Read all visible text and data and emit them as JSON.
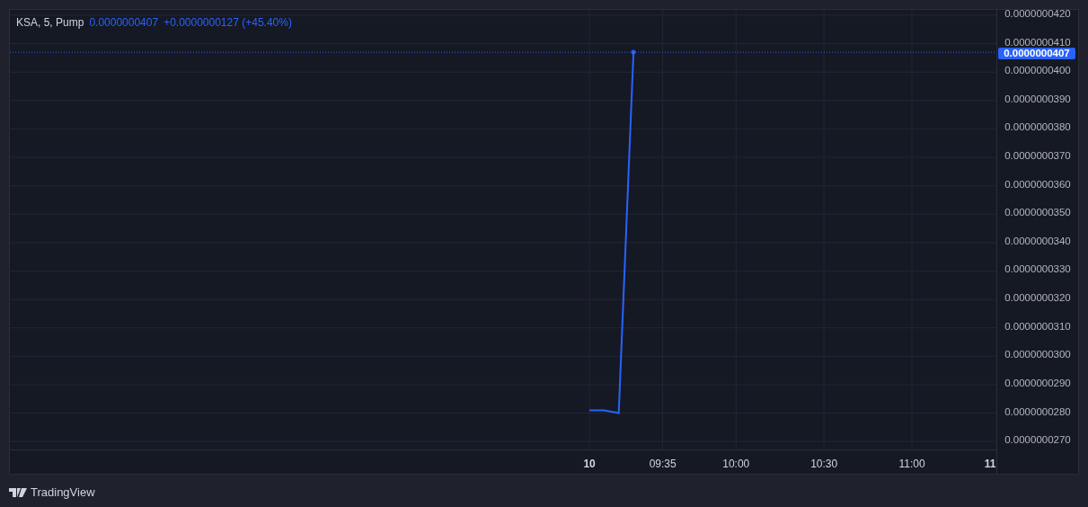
{
  "legend": {
    "symbol": "KSA, 5, Pump",
    "price": "0.0000000407",
    "change": "+0.0000000127 (+45.40%)"
  },
  "chart_data": {
    "type": "line",
    "x": [
      550,
      555,
      560,
      565
    ],
    "series": [
      {
        "color": "#2962ff",
        "values": [
          2.81e-08,
          2.81e-08,
          2.8e-08,
          4.07e-08
        ]
      }
    ],
    "xlim": [
      352.3,
      689.1
    ],
    "ylim": [
      2.672e-08,
      4.219e-08
    ],
    "grid": true,
    "ref_lines": [
      {
        "axis": "y",
        "value": 4.07e-08,
        "label": "0.0000000407"
      }
    ],
    "xticks": [
      {
        "value": 575,
        "label": "09:35"
      },
      {
        "value": 600,
        "label": "10:00"
      },
      {
        "value": 630,
        "label": "10:30"
      },
      {
        "value": 660,
        "label": "11:00"
      }
    ],
    "yticks": [
      {
        "value": 4.2e-08,
        "label": "0.0000000420"
      },
      {
        "value": 4.1e-08,
        "label": "0.0000000410"
      },
      {
        "value": 4e-08,
        "label": "0.0000000400"
      },
      {
        "value": 3.9e-08,
        "label": "0.0000000390"
      },
      {
        "value": 3.8e-08,
        "label": "0.0000000380"
      },
      {
        "value": 3.7e-08,
        "label": "0.0000000370"
      },
      {
        "value": 3.6e-08,
        "label": "0.0000000360"
      },
      {
        "value": 3.5e-08,
        "label": "0.0000000350"
      },
      {
        "value": 3.4e-08,
        "label": "0.0000000340"
      },
      {
        "value": 3.3e-08,
        "label": "0.0000000330"
      },
      {
        "value": 3.2e-08,
        "label": "0.0000000320"
      },
      {
        "value": 3.1e-08,
        "label": "0.0000000310"
      },
      {
        "value": 3e-08,
        "label": "0.0000000300"
      },
      {
        "value": 2.9e-08,
        "label": "0.0000000290"
      },
      {
        "value": 2.8e-08,
        "label": "0.0000000280"
      },
      {
        "value": 2.7e-08,
        "label": "0.0000000270"
      }
    ]
  },
  "day_labels": [
    "10",
    "11"
  ],
  "brand": "TradingView"
}
